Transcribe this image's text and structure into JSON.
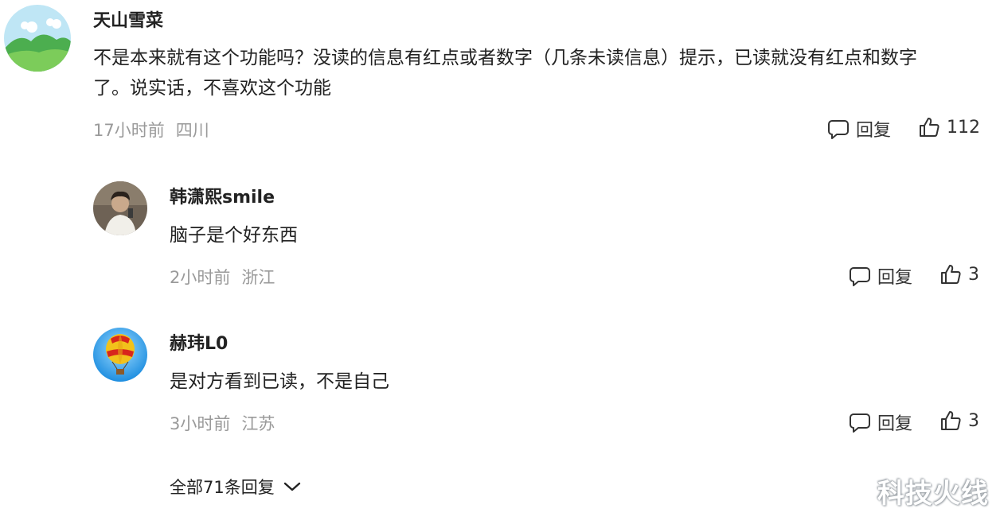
{
  "comments": [
    {
      "user": "天山雪菜",
      "text_line1": "不是本来就有这个功能吗？没读的信息有红点或者数字（几条未读信息）提示，已读就没有红点和数字",
      "text_line2": "了。说实话，不喜欢这个功能",
      "time": "17小时前",
      "location": "四川",
      "reply_label": "回复",
      "likes": "112",
      "avatar_icon": "landscape-avatar-icon"
    }
  ],
  "replies": [
    {
      "user": "韩潇熙smile",
      "text": "脑子是个好东西",
      "time": "2小时前",
      "location": "浙江",
      "reply_label": "回复",
      "likes": "3",
      "avatar_icon": "person-photo-avatar-icon"
    },
    {
      "user": "赫玮L0",
      "text": "是对方看到已读，不是自己",
      "time": "3小时前",
      "location": "江苏",
      "reply_label": "回复",
      "likes": "3",
      "avatar_icon": "hot-air-balloon-avatar-icon"
    }
  ],
  "more_replies_label": "全部71条回复",
  "watermark": "科技火线"
}
